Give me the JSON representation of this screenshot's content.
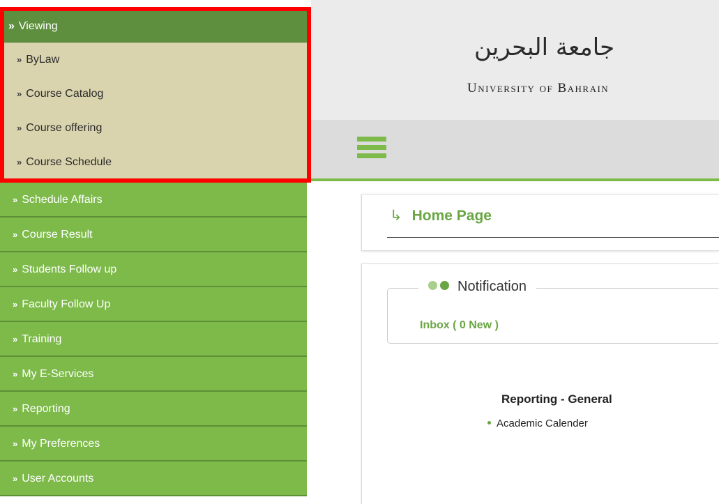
{
  "sidebar": {
    "viewing": {
      "label": "Viewing",
      "items": [
        "ByLaw",
        "Course Catalog",
        "Course offering",
        "Course Schedule"
      ]
    },
    "menu": [
      "Schedule Affairs",
      "Course Result",
      "Students Follow up",
      "Faculty Follow Up",
      "Training",
      "My E-Services",
      "Reporting",
      "My Preferences",
      "User Accounts"
    ],
    "bullet": "»"
  },
  "header": {
    "logo_arabic": "جامعة البحرين",
    "logo_english": "University of Bahrain"
  },
  "home": {
    "arrow": "↳",
    "title": "Home Page"
  },
  "notification": {
    "legend": "Notification",
    "inbox": "Inbox ( 0 New )"
  },
  "reporting": {
    "title": "Reporting - General",
    "items": [
      "Academic Calender"
    ]
  },
  "colors": {
    "green": "#7dba4a",
    "dark_green": "#5e8f3e",
    "highlight_border": "#ff0000",
    "submenu_bg": "#d9d3ae"
  }
}
